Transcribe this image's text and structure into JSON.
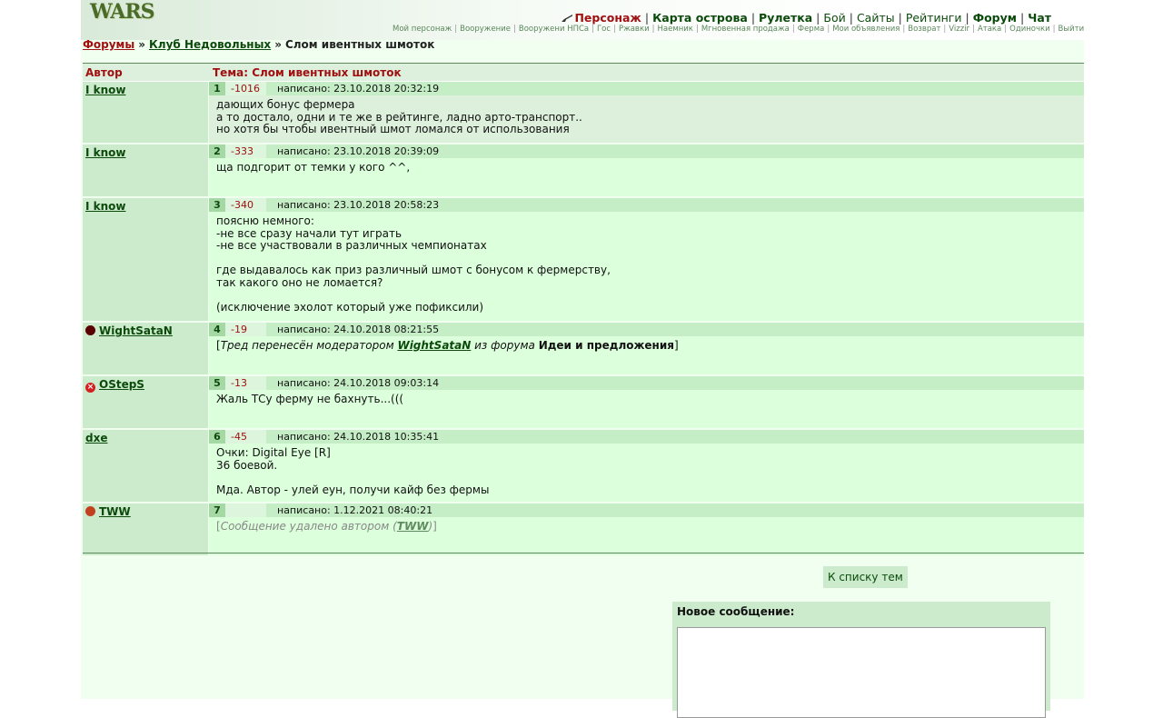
{
  "header": {
    "logo": "WARS",
    "nav": [
      {
        "label": "Персонаж",
        "state": "active"
      },
      {
        "label": "Карта острова",
        "state": "bold"
      },
      {
        "label": "Рулетка",
        "state": "bold"
      },
      {
        "label": "Бой",
        "state": "normal"
      },
      {
        "label": "Сайты",
        "state": "normal"
      },
      {
        "label": "Рейтинги",
        "state": "normal"
      },
      {
        "label": "Форум",
        "state": "bold"
      },
      {
        "label": "Чат",
        "state": "bold"
      }
    ],
    "subnav": [
      "Мой персонаж",
      "Вооружение",
      "Вооружени НПСа",
      "Гос",
      "Ржавки",
      "Наемник",
      "Мгновенная продажа",
      "Ферма",
      "Мои объявления",
      "Возврат",
      "Vizzir",
      "Атака",
      "Одиночки",
      "Выйти из"
    ]
  },
  "breadcrumb": {
    "forums": "Форумы",
    "club": "Клуб Недовольных",
    "topic": "Слом ивентных шмоток",
    "separator": "»"
  },
  "table": {
    "author_header": "Автор",
    "topic_header": "Тема: Слом ивентных шмоток"
  },
  "posts": [
    {
      "author": "I know",
      "icon": "",
      "num": "1",
      "rating": "-1016",
      "date": "написано: 23.10.2018 20:32:19",
      "text": "дающих бонус фермера\nа то достало, одни и те же в рейтинге, ладно арто-транспорт..\nно хотя бы чтобы ивентный шмот ломался от использования"
    },
    {
      "author": "I know",
      "icon": "",
      "num": "2",
      "rating": "-333",
      "date": "написано: 23.10.2018 20:39:09",
      "text": "ща подгорит от темки у кого ^^,"
    },
    {
      "author": "I know",
      "icon": "",
      "num": "3",
      "rating": "-340",
      "date": "написано: 23.10.2018 20:58:23",
      "text": "поясню немного:\n-не все сразу начали тут играть\n-не все участвовали в различных чемпионатах\n\nгде выдавалось как приз различный шмот с бонусом к фермерству,\nтак какого оно не ломается?\n\n(исключение эхолот который уже пофиксили)"
    },
    {
      "author": "WightSataN",
      "icon": "dark-badge-icon",
      "num": "4",
      "rating": "-19",
      "date": "написано: 24.10.2018 08:21:55",
      "moved": {
        "prefix": "[",
        "a": "Тред перенесён модератором",
        "moderator": "WightSataN",
        "b": "из форума",
        "forum": "Идеи и предложения",
        "suffix": "]"
      }
    },
    {
      "author": "OStepS",
      "icon": "red-x-icon",
      "num": "5",
      "rating": "-13",
      "date": "написано: 24.10.2018 09:03:14",
      "text": "Жаль ТСу ферму не бахнуть...((("
    },
    {
      "author": "dxe",
      "icon": "",
      "num": "6",
      "rating": "-45",
      "date": "написано: 24.10.2018 10:35:41",
      "text": "Очки: Digital Eye [R]\n36 боевой.\n\nМда. Автор - улей еун, получи кайф без фермы"
    },
    {
      "author": "TWW",
      "icon": "clan-badge-icon",
      "num": "7",
      "rating": "",
      "date": "написано: 1.12.2021 08:40:21",
      "deleted": {
        "prefix": "[",
        "a": "Сообщение удалено автором",
        "open": "(",
        "name": "TWW",
        "close": ")",
        "suffix": "]"
      }
    }
  ],
  "back_button": "К списку тем",
  "new_message": {
    "label": "Новое сообщение:",
    "value": ""
  }
}
